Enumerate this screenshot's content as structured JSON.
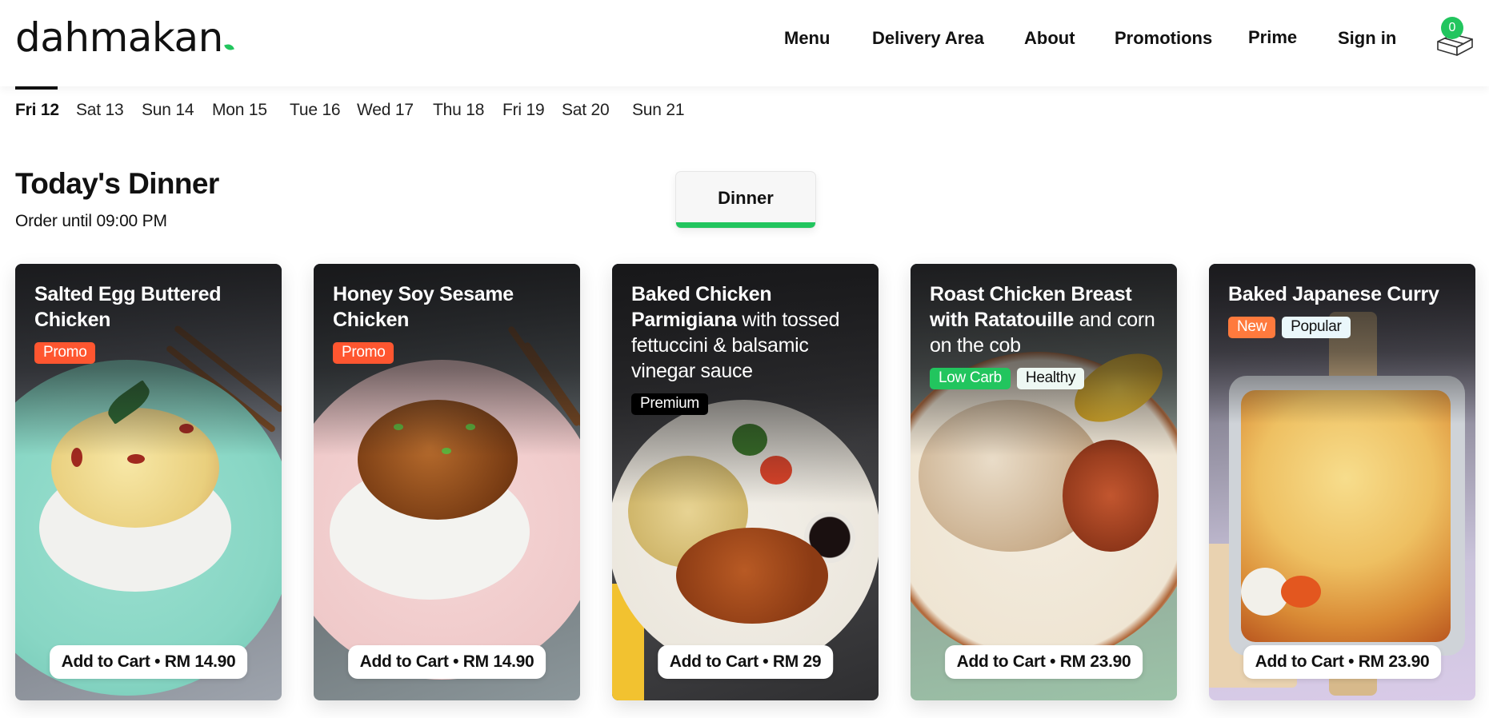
{
  "header": {
    "logo": "dahmakan",
    "nav": [
      {
        "label": "Menu"
      },
      {
        "label": "Delivery Area"
      },
      {
        "label": "About"
      },
      {
        "label": "Promotions"
      },
      {
        "label": "Prime"
      },
      {
        "label": "Sign in"
      }
    ],
    "cart": {
      "icon": "box-cart-icon",
      "count": "0"
    }
  },
  "date_tabs": [
    {
      "label": "Fri 12",
      "active": true
    },
    {
      "label": "Sat 13"
    },
    {
      "label": "Sun 14"
    },
    {
      "label": "Mon 15"
    },
    {
      "label": "Tue 16"
    },
    {
      "label": "Wed 17"
    },
    {
      "label": "Thu 18"
    },
    {
      "label": "Fri 19"
    },
    {
      "label": "Sat 20"
    },
    {
      "label": "Sun 21"
    }
  ],
  "section": {
    "title": "Today's Dinner",
    "subtitle": "Order until 09:00 PM"
  },
  "meal_tab": {
    "label": "Dinner"
  },
  "cards": [
    {
      "name_bold": "Salted Egg Buttered Chicken",
      "name_rest": "",
      "tags": [
        {
          "label": "Promo",
          "bg": "#ff5630",
          "color": "#ffffff"
        }
      ],
      "button": "Add to Cart • RM 14.90"
    },
    {
      "name_bold": "Honey Soy Sesame Chicken",
      "name_rest": "",
      "tags": [
        {
          "label": "Promo",
          "bg": "#ff5630",
          "color": "#ffffff"
        }
      ],
      "button": "Add to Cart • RM 14.90"
    },
    {
      "name_bold": "Baked Chicken Parmigiana",
      "name_rest": " with tossed fettuccini & balsamic vinegar sauce",
      "tags": [
        {
          "label": "Premium",
          "bg": "#000000",
          "color": "#ffffff"
        }
      ],
      "button": "Add to Cart • RM 29"
    },
    {
      "name_bold": "Roast Chicken Breast with Ratatouille",
      "name_rest": " and corn on the cob",
      "tags": [
        {
          "label": "Low Carb",
          "bg": "#22c55e",
          "color": "#ffffff"
        },
        {
          "label": "Healthy",
          "bg": "#eef8f3",
          "color": "#111111"
        }
      ],
      "button": "Add to Cart • RM 23.90"
    },
    {
      "name_bold": "Baked Japanese Curry",
      "name_rest": "",
      "tags": [
        {
          "label": "New",
          "bg": "#ff7a3d",
          "color": "#ffffff"
        },
        {
          "label": "Popular",
          "bg": "#eaf7fb",
          "color": "#111111"
        }
      ],
      "button": "Add to Cart • RM 23.90"
    }
  ],
  "colors": {
    "accent_green": "#22c55e",
    "promo": "#ff5630",
    "new": "#ff7a3d"
  }
}
